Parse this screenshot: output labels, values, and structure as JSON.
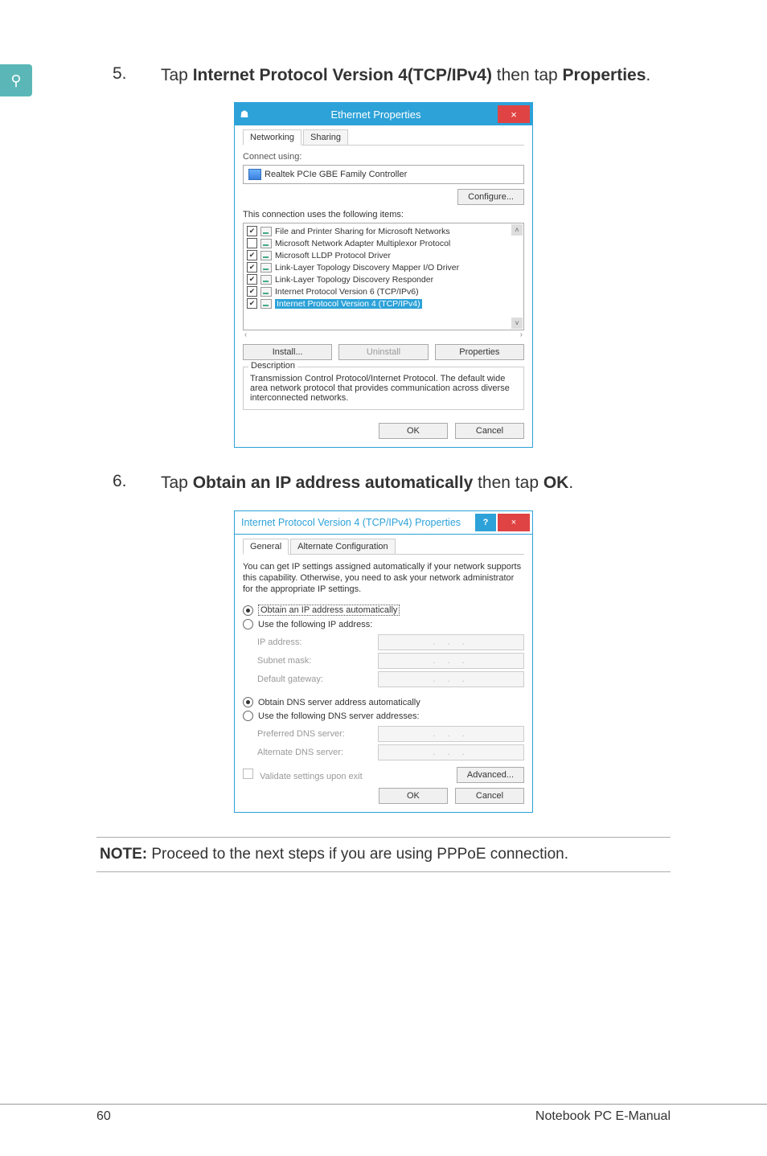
{
  "search_icon_glyph": "⚲",
  "step5": {
    "num": "5.",
    "pre": "Tap ",
    "bold1": "Internet Protocol Version 4(TCP/IPv4)",
    "mid": " then tap ",
    "bold2": "Properties",
    "post": "."
  },
  "step6": {
    "num": "6.",
    "pre": "Tap ",
    "bold1": "Obtain an IP address automatically",
    "mid": " then tap ",
    "bold2": "OK",
    "post": "."
  },
  "dlg1": {
    "title": "Ethernet Properties",
    "close": "×",
    "tab_networking": "Networking",
    "tab_sharing": "Sharing",
    "connect_using": "Connect using:",
    "device": "Realtek PCIe GBE Family Controller",
    "configure": "Configure...",
    "list_label": "This connection uses the following items:",
    "items": [
      {
        "checked": true,
        "label": "File and Printer Sharing for Microsoft Networks"
      },
      {
        "checked": false,
        "label": "Microsoft Network Adapter Multiplexor Protocol"
      },
      {
        "checked": true,
        "label": "Microsoft LLDP Protocol Driver"
      },
      {
        "checked": true,
        "label": "Link-Layer Topology Discovery Mapper I/O Driver"
      },
      {
        "checked": true,
        "label": "Link-Layer Topology Discovery Responder"
      },
      {
        "checked": true,
        "label": "Internet Protocol Version 6 (TCP/IPv6)"
      },
      {
        "checked": true,
        "label": "Internet Protocol Version 4 (TCP/IPv4)",
        "selected": true
      }
    ],
    "install": "Install...",
    "uninstall": "Uninstall",
    "properties": "Properties",
    "desc_legend": "Description",
    "desc_text": "Transmission Control Protocol/Internet Protocol. The default wide area network protocol that provides communication across diverse interconnected networks.",
    "ok": "OK",
    "cancel": "Cancel"
  },
  "dlg2": {
    "title": "Internet Protocol Version 4 (TCP/IPv4) Properties",
    "help": "?",
    "close": "×",
    "tab_general": "General",
    "tab_alt": "Alternate Configuration",
    "info": "You can get IP settings assigned automatically if your network supports this capability. Otherwise, you need to ask your network administrator for the appropriate IP settings.",
    "r_obtain_ip": "Obtain an IP address automatically",
    "r_use_ip": "Use the following IP address:",
    "f_ip": "IP address:",
    "f_mask": "Subnet mask:",
    "f_gw": "Default gateway:",
    "r_obtain_dns": "Obtain DNS server address automatically",
    "r_use_dns": "Use the following DNS server addresses:",
    "f_pref": "Preferred DNS server:",
    "f_alt": "Alternate DNS server:",
    "validate": "Validate settings upon exit",
    "advanced": "Advanced...",
    "ok": "OK",
    "cancel": "Cancel",
    "ip_dots": ".   .   ."
  },
  "note": {
    "bold": "NOTE:",
    "text": " Proceed to the next steps if you are using PPPoE connection."
  },
  "footer": {
    "page": "60",
    "title": "Notebook PC E-Manual"
  }
}
